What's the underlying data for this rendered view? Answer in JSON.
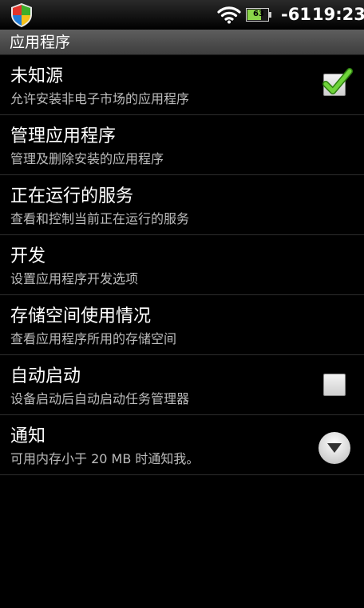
{
  "status_bar": {
    "battery_level": "63",
    "signal": "-61",
    "time": "19:23",
    "icons": [
      "shield-icon",
      "wifi-icon",
      "battery-icon"
    ]
  },
  "title_bar": {
    "title": "应用程序"
  },
  "preferences": [
    {
      "title": "未知源",
      "summary": "允许安装非电子市场的应用程序",
      "widget": "checkbox",
      "checked": true
    },
    {
      "title": "管理应用程序",
      "summary": "管理及删除安装的应用程序"
    },
    {
      "title": "正在运行的服务",
      "summary": "查看和控制当前正在运行的服务"
    },
    {
      "title": "开发",
      "summary": "设置应用程序开发选项"
    },
    {
      "title": "存储空间使用情况",
      "summary": "查看应用程序所用的存储空间"
    },
    {
      "title": "自动启动",
      "summary": "设备启动后自动启动任务管理器",
      "widget": "checkbox",
      "checked": false
    },
    {
      "title": "通知",
      "summary": "可用内存小于 20 MB 时通知我。",
      "widget": "dropdown"
    }
  ],
  "colors": {
    "background": "#000000",
    "check_green": "#5fc52a",
    "summary_text": "#bcbcbc"
  }
}
